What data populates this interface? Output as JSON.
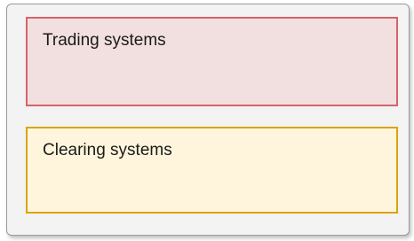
{
  "diagram": {
    "boxes": [
      {
        "label": "Trading systems",
        "fill": "#f2e0e1",
        "border": "#d6636a"
      },
      {
        "label": "Clearing systems",
        "fill": "#fff5dc",
        "border": "#d8a50c"
      }
    ]
  }
}
